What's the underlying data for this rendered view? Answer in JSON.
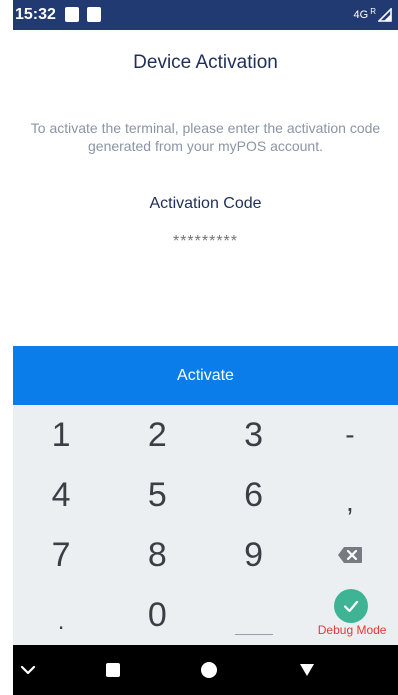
{
  "status_bar": {
    "time": "15:32",
    "network": "4G",
    "signal_sup": "R"
  },
  "screen": {
    "title": "Device Activation",
    "instructions": "To activate the terminal, please enter the activation code generated from your myPOS account.",
    "code_label": "Activation Code",
    "code_placeholder": "*********"
  },
  "activate_button": {
    "label": "Activate"
  },
  "keypad": {
    "keys": [
      "1",
      "2",
      "3",
      "-",
      "4",
      "5",
      "6",
      ",",
      "7",
      "8",
      "9",
      ".",
      "0"
    ]
  },
  "debug": {
    "label": "Debug Mode"
  },
  "nav_bar": {
    "icons": [
      "chevron-down-icon",
      "square-icon",
      "circle-icon",
      "triangle-icon"
    ]
  },
  "colors": {
    "status_bar": "#223a72",
    "primary": "#0a7dea",
    "keypad_bg": "#eceff1",
    "fab": "#3fb494",
    "debug_text": "#e53935"
  }
}
